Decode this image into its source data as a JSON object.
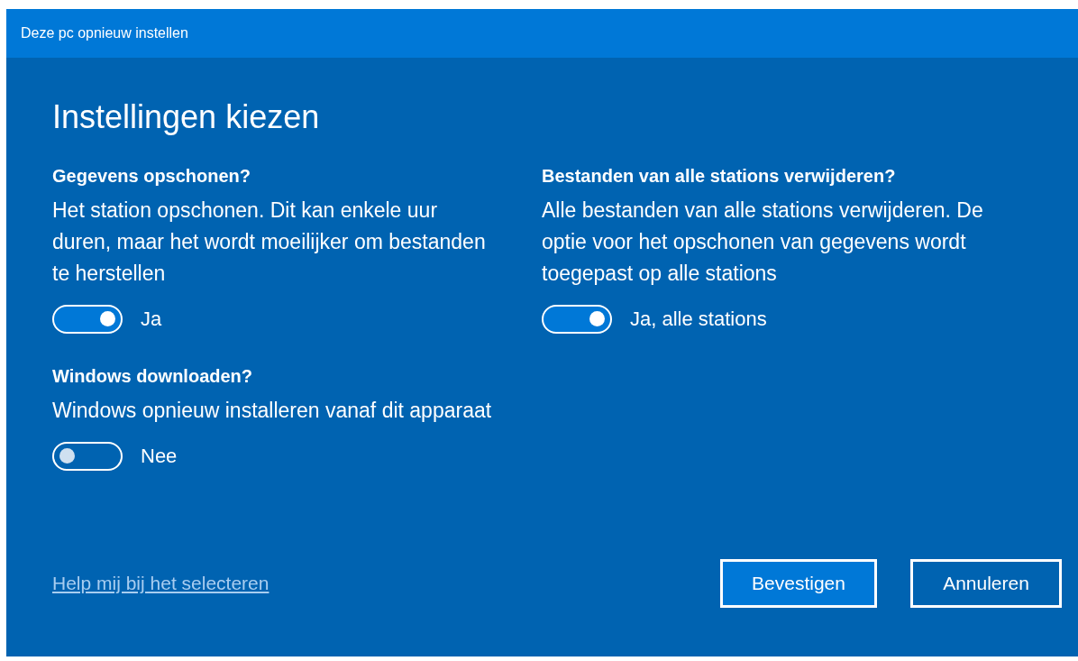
{
  "window": {
    "title": "Deze pc opnieuw instellen"
  },
  "heading": "Instellingen kiezen",
  "left_column": [
    {
      "title": "Gegevens opschonen?",
      "description": "Het station opschonen. Dit kan enkele uur duren, maar het wordt moeilijker om bestanden te herstellen",
      "toggle": {
        "on": true,
        "label": "Ja"
      }
    },
    {
      "title": "Windows downloaden?",
      "description": "Windows opnieuw installeren vanaf dit apparaat",
      "toggle": {
        "on": false,
        "label": "Nee"
      }
    }
  ],
  "right_column": [
    {
      "title": "Bestanden van alle stations verwijderen?",
      "description": "Alle bestanden van alle stations verwijderen. De optie voor het opschonen van gegevens wordt toegepast op alle stations",
      "toggle": {
        "on": true,
        "label": "Ja, alle stations"
      }
    }
  ],
  "help_link": "Help mij bij het selecteren",
  "buttons": [
    {
      "label": "Bevestigen",
      "default": true
    },
    {
      "label": "Annuleren",
      "default": false
    }
  ]
}
